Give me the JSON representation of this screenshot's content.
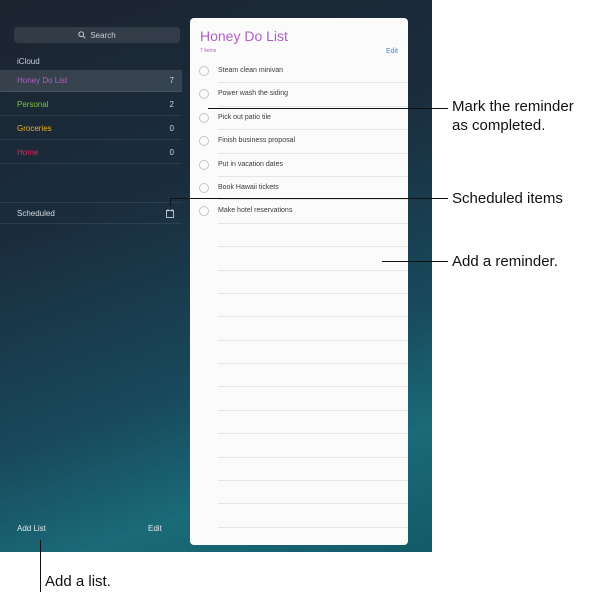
{
  "sidebar": {
    "search_label": "Search",
    "section": "iCloud",
    "lists": [
      {
        "label": "Honey Do List",
        "count": "7",
        "color": "#b15fc1",
        "selected": true
      },
      {
        "label": "Personal",
        "count": "2",
        "color": "#78c43a"
      },
      {
        "label": "Groceries",
        "count": "0",
        "color": "#e6b21e"
      },
      {
        "label": "Home",
        "count": "0",
        "color": "#e2245c"
      }
    ],
    "scheduled_label": "Scheduled",
    "add_list_label": "Add List",
    "edit_label": "Edit"
  },
  "panel": {
    "title": "Honey Do List",
    "subtitle": "7 items",
    "edit_label": "Edit",
    "reminders": [
      "Steam clean minivan",
      "Power wash the siding",
      "Pick out patio tile",
      "Finish business proposal",
      "Put in vacation dates",
      "Book Hawaii tickets",
      "Make hotel reservations"
    ]
  },
  "callouts": {
    "mark_line1": "Mark the reminder",
    "mark_line2": "as completed.",
    "scheduled": "Scheduled items",
    "add_reminder": "Add a reminder.",
    "add_list": "Add a list."
  }
}
